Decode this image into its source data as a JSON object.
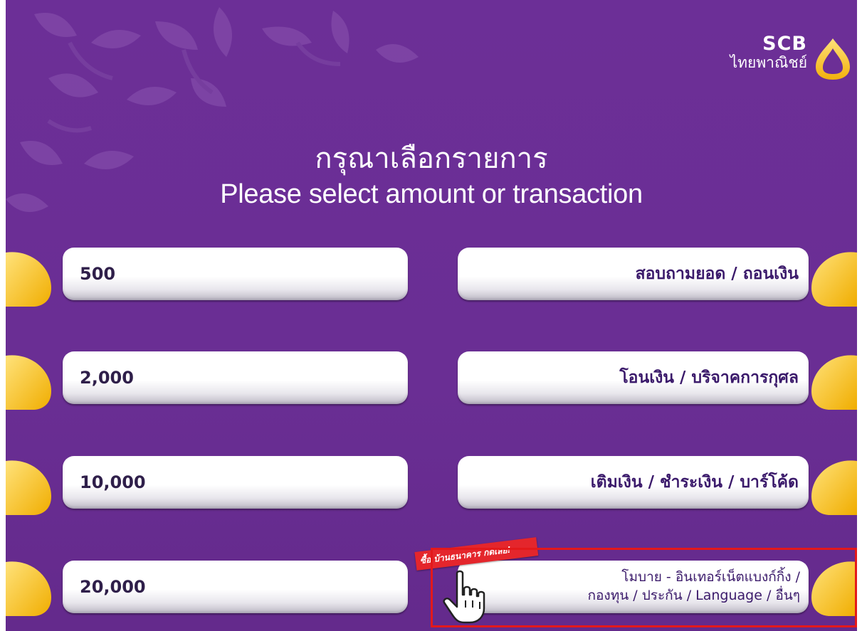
{
  "brand": {
    "name": "SCB",
    "thai_name": "ไทยพาณิชย์"
  },
  "heading": {
    "thai": "กรุณาเลือกรายการ",
    "english": "Please select amount or transaction"
  },
  "amount_buttons": [
    {
      "label": "500"
    },
    {
      "label": "2,000"
    },
    {
      "label": "10,000"
    },
    {
      "label": "20,000"
    }
  ],
  "transaction_buttons": [
    {
      "label": "สอบถามยอด / ถอนเงิน"
    },
    {
      "label": "โอนเงิน / บริจาคการกุศล"
    },
    {
      "label": "เติมเงิน / ชำระเงิน / บาร์โค้ด"
    },
    {
      "line1": "โมบาย - อินเทอร์เน็ตแบงก์กิ้ง /",
      "line2": "กองทุน / ประกัน / Language / อื่นๆ"
    }
  ],
  "promo_ribbon": "ซื้อ บ้านธนาคาร กดเลย!",
  "colors": {
    "background": "#6a2e94",
    "button_text": "#3b1a6b",
    "leaf_gold": "#f5c21b",
    "highlight": "#e3191b",
    "ribbon": "#e4262c"
  },
  "icons": [
    "scb-logo-icon",
    "hand-pointer-icon",
    "gold-leaf-icon"
  ]
}
